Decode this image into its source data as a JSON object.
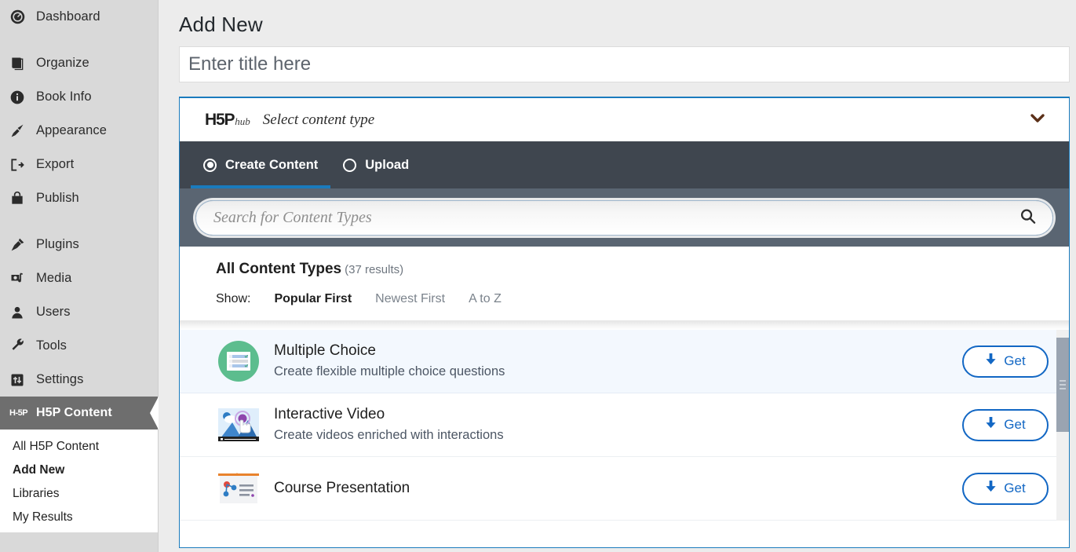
{
  "sidebar": {
    "items": [
      {
        "label": "Dashboard",
        "icon": "dashboard-icon"
      },
      {
        "label": "Organize",
        "icon": "book-icon"
      },
      {
        "label": "Book Info",
        "icon": "info-icon"
      },
      {
        "label": "Appearance",
        "icon": "paintbrush-icon"
      },
      {
        "label": "Export",
        "icon": "export-icon"
      },
      {
        "label": "Publish",
        "icon": "publish-bag-icon"
      },
      {
        "label": "Plugins",
        "icon": "plug-icon"
      },
      {
        "label": "Media",
        "icon": "media-icon"
      },
      {
        "label": "Users",
        "icon": "user-icon"
      },
      {
        "label": "Tools",
        "icon": "wrench-icon"
      },
      {
        "label": "Settings",
        "icon": "sliders-icon"
      }
    ],
    "active": {
      "label": "H5P Content",
      "icon": "h5p-icon",
      "badge": "H-5P"
    },
    "submenu": [
      {
        "label": "All H5P Content",
        "current": false
      },
      {
        "label": "Add New",
        "current": true
      },
      {
        "label": "Libraries",
        "current": false
      },
      {
        "label": "My Results",
        "current": false
      }
    ]
  },
  "main": {
    "page_title": "Add New",
    "title_input": {
      "value": "",
      "placeholder": "Enter title here"
    }
  },
  "hub": {
    "logo_main": "H5P",
    "logo_sub": "hub",
    "header_label": "Select content type",
    "chevron_icon": "chevron-down-icon",
    "tabs": [
      {
        "label": "Create Content",
        "active": true
      },
      {
        "label": "Upload",
        "active": false
      }
    ],
    "search": {
      "value": "",
      "placeholder": "Search for Content Types",
      "icon": "search-icon"
    },
    "results_title": "All Content Types",
    "results_count": "(37 results)",
    "show_label": "Show:",
    "filters": [
      {
        "label": "Popular First",
        "active": true
      },
      {
        "label": "Newest First",
        "active": false
      },
      {
        "label": "A to Z",
        "active": false
      }
    ],
    "content_types": [
      {
        "name": "Multiple Choice",
        "description": "Create flexible multiple choice questions",
        "icon": "multiple-choice-icon",
        "button": "Get",
        "highlighted": true
      },
      {
        "name": "Interactive Video",
        "description": "Create videos enriched with interactions",
        "icon": "interactive-video-icon",
        "button": "Get",
        "highlighted": false
      },
      {
        "name": "Course Presentation",
        "description": "",
        "icon": "course-presentation-icon",
        "button": "Get",
        "highlighted": false
      }
    ],
    "colors": {
      "accent_blue": "#1a7bbd",
      "tab_bar": "#3f464f",
      "search_bar": "#5a6572",
      "get_button": "#1267c4",
      "row_highlight": "#f3f8fe"
    }
  }
}
